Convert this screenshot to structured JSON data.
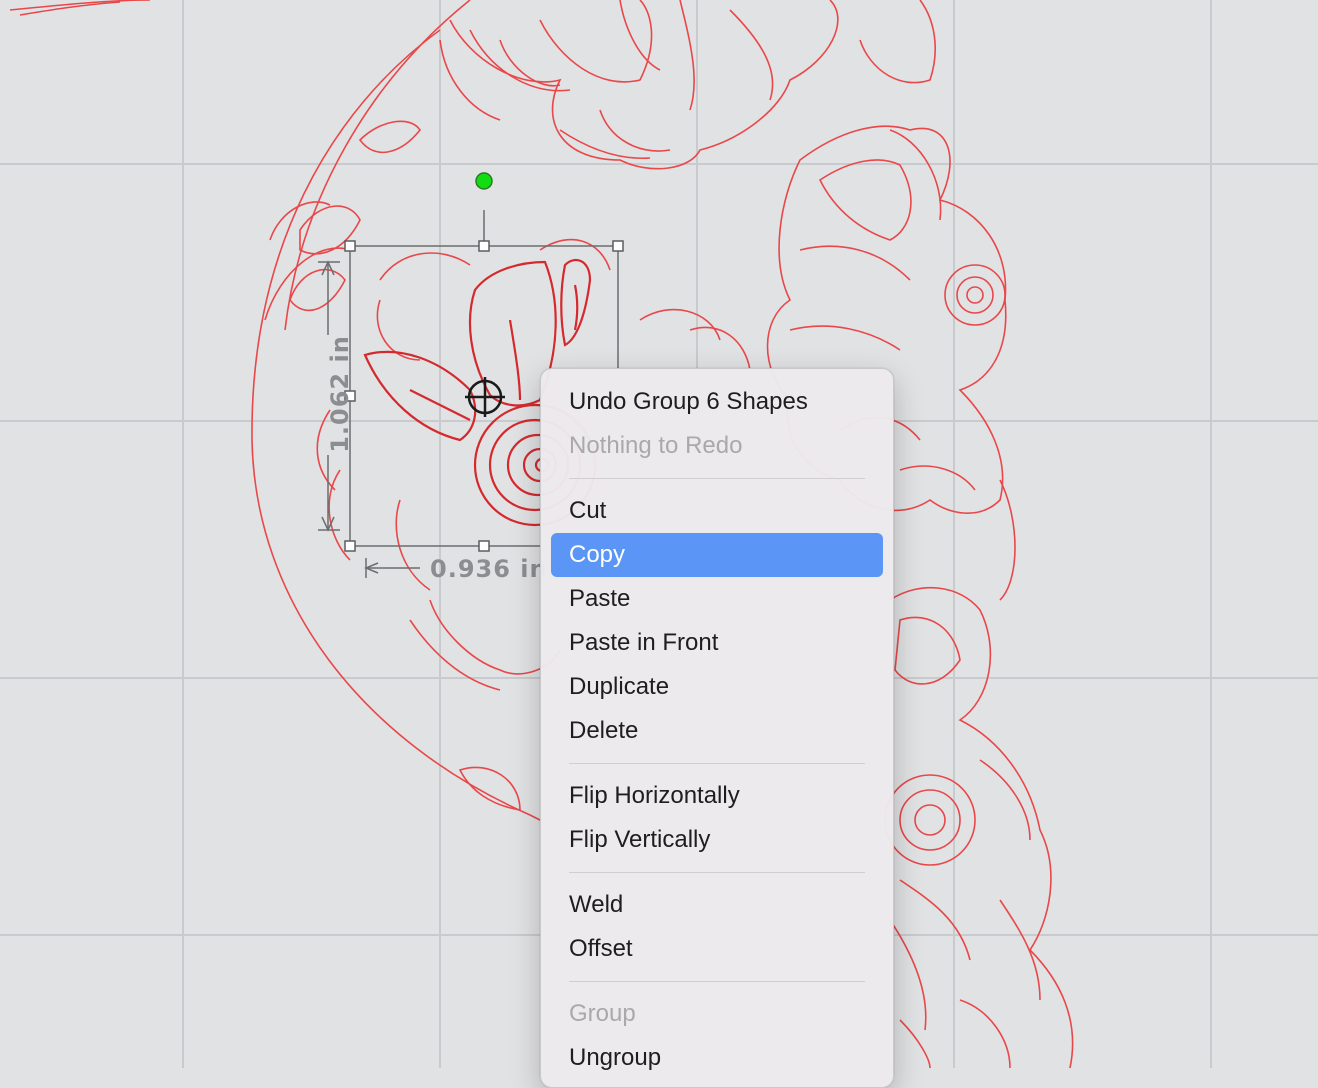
{
  "canvas": {
    "grid_color": "#c8cacd",
    "background": "#e1e2e4",
    "design_color": "#e8484a",
    "selected_color": "#d42a2e",
    "rotate_handle_color": "#11dd11"
  },
  "dimensions": {
    "width_label": "0.936 in",
    "height_label": "1.062 in"
  },
  "context_menu": {
    "highlight_color": "#5b95f5",
    "sections": [
      {
        "items": [
          {
            "label": "Undo Group 6 Shapes",
            "enabled": true
          },
          {
            "label": "Nothing to Redo",
            "enabled": false
          }
        ]
      },
      {
        "items": [
          {
            "label": "Cut",
            "enabled": true
          },
          {
            "label": "Copy",
            "enabled": true,
            "highlighted": true
          },
          {
            "label": "Paste",
            "enabled": true
          },
          {
            "label": "Paste in Front",
            "enabled": true
          },
          {
            "label": "Duplicate",
            "enabled": true
          },
          {
            "label": "Delete",
            "enabled": true
          }
        ]
      },
      {
        "items": [
          {
            "label": "Flip Horizontally",
            "enabled": true
          },
          {
            "label": "Flip Vertically",
            "enabled": true
          }
        ]
      },
      {
        "items": [
          {
            "label": "Weld",
            "enabled": true
          },
          {
            "label": "Offset",
            "enabled": true
          }
        ]
      },
      {
        "items": [
          {
            "label": "Group",
            "enabled": false
          },
          {
            "label": "Ungroup",
            "enabled": true
          }
        ]
      }
    ]
  }
}
